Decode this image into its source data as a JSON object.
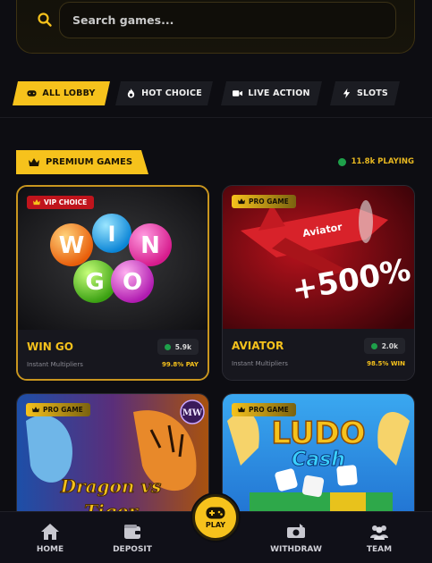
{
  "search": {
    "placeholder": "Search games..."
  },
  "tabs": [
    {
      "label": "ALL LOBBY",
      "icon": "gamepad-icon",
      "active": true
    },
    {
      "label": "HOT CHOICE",
      "icon": "fire-icon",
      "active": false
    },
    {
      "label": "LIVE ACTION",
      "icon": "video-camera-icon",
      "active": false
    },
    {
      "label": "SLOTS",
      "icon": "lightning-icon",
      "active": false
    }
  ],
  "section": {
    "title": "PREMIUM GAMES",
    "playing": "11.8k PLAYING"
  },
  "games": [
    {
      "badge": "VIP CHOICE",
      "name": "WIN GO",
      "subtitle": "Instant Multipliers",
      "players": "5.9k",
      "rtp": "99.8% PAY",
      "art_text": [
        "W",
        "I",
        "N",
        "G",
        "O"
      ]
    },
    {
      "badge": "PRO GAME",
      "name": "AVIATOR",
      "subtitle": "Instant Multipliers",
      "players": "2.0k",
      "rtp": "98.5% WIN",
      "art_text": [
        "Aviator",
        "+500%"
      ]
    },
    {
      "badge": "PRO GAME",
      "name": "Dragon vs Tiger",
      "art_text": [
        "Dragon vs",
        "Tiger",
        "MW"
      ]
    },
    {
      "badge": "PRO GAME",
      "name": "Ludo Cash",
      "art_text": [
        "LUDO",
        "Cash"
      ]
    }
  ],
  "bottom_nav": [
    {
      "label": "HOME",
      "icon": "home-icon"
    },
    {
      "label": "DEPOSIT",
      "icon": "wallet-icon"
    },
    {
      "label": "PLAY",
      "icon": "gamepad-icon"
    },
    {
      "label": "WITHDRAW",
      "icon": "cash-icon"
    },
    {
      "label": "TEAM",
      "icon": "team-icon"
    }
  ],
  "colors": {
    "accent": "#f6c21c",
    "background": "#0d0d12",
    "live": "#1ea04a",
    "vip": "#c0141c"
  }
}
